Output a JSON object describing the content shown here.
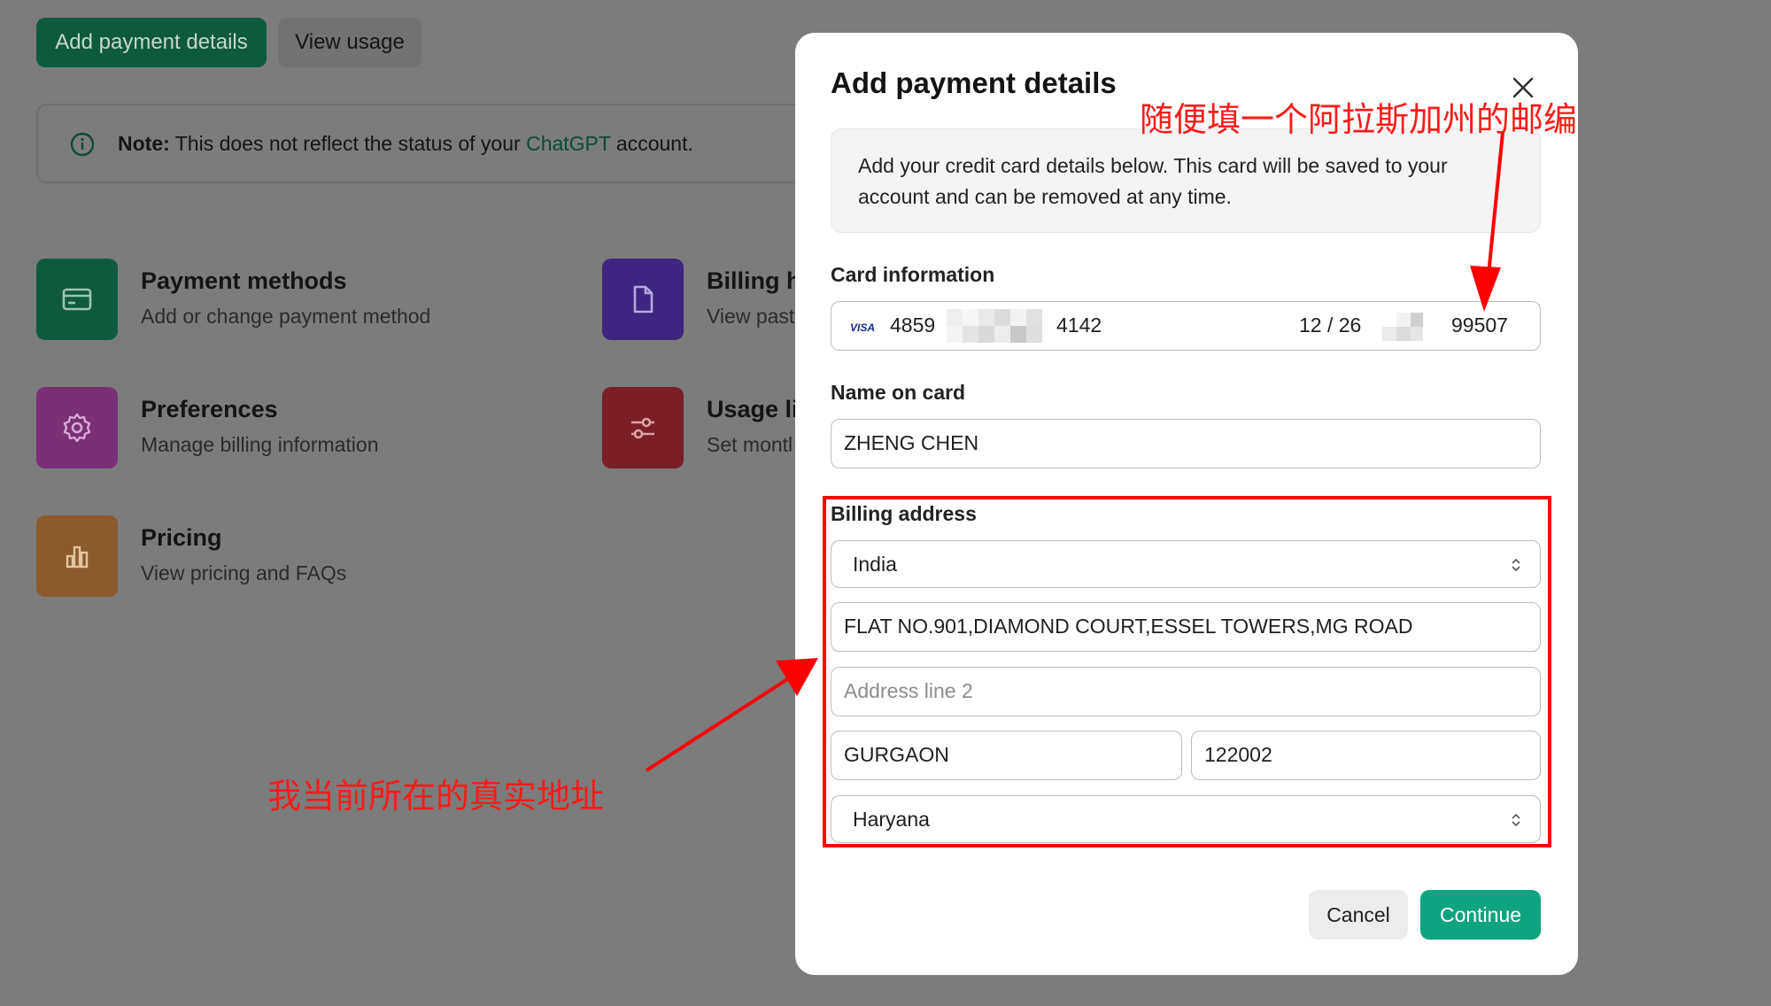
{
  "background": {
    "buttons": {
      "add_payment": "Add payment details",
      "view_usage": "View usage"
    },
    "note": {
      "label": "Note:",
      "text_before": " This does not reflect the status of your ",
      "link": "ChatGPT",
      "text_after": " account."
    },
    "tiles": [
      {
        "title": "Payment methods",
        "subtitle": "Add or change payment method",
        "color": "#0f5a3f",
        "icon": "card-icon"
      },
      {
        "title": "Billing h",
        "subtitle": "View past",
        "color": "#3d2580",
        "icon": "document-icon"
      },
      {
        "title": "Preferences",
        "subtitle": "Manage billing information",
        "color": "#7a2f77",
        "icon": "gear-icon"
      },
      {
        "title": "Usage li",
        "subtitle": "Set montl",
        "color": "#7a1e27",
        "icon": "sliders-icon"
      },
      {
        "title": "Pricing",
        "subtitle": "View pricing and FAQs",
        "color": "#8a5a2c",
        "icon": "bar-chart-icon"
      }
    ]
  },
  "modal": {
    "title": "Add payment details",
    "info": "Add your credit card details below. This card will be saved to your account and can be removed at any time.",
    "card_label": "Card information",
    "card": {
      "brand": "VISA",
      "first": "4859",
      "last": "4142",
      "expiry": "12 / 26",
      "zip": "99507"
    },
    "name_label": "Name on card",
    "name_value": "ZHENG CHEN",
    "billing_label": "Billing address",
    "country": "India",
    "address1": "FLAT NO.901,DIAMOND COURT,ESSEL TOWERS,MG ROAD",
    "address2_placeholder": "Address line 2",
    "city": "GURGAON",
    "postal": "122002",
    "state": "Haryana",
    "cancel": "Cancel",
    "continue": "Continue"
  },
  "annotations": {
    "top_right": "随便填一个阿拉斯加州的邮编",
    "bottom_left": "我当前所在的真实地址",
    "color": "#ff0000"
  }
}
